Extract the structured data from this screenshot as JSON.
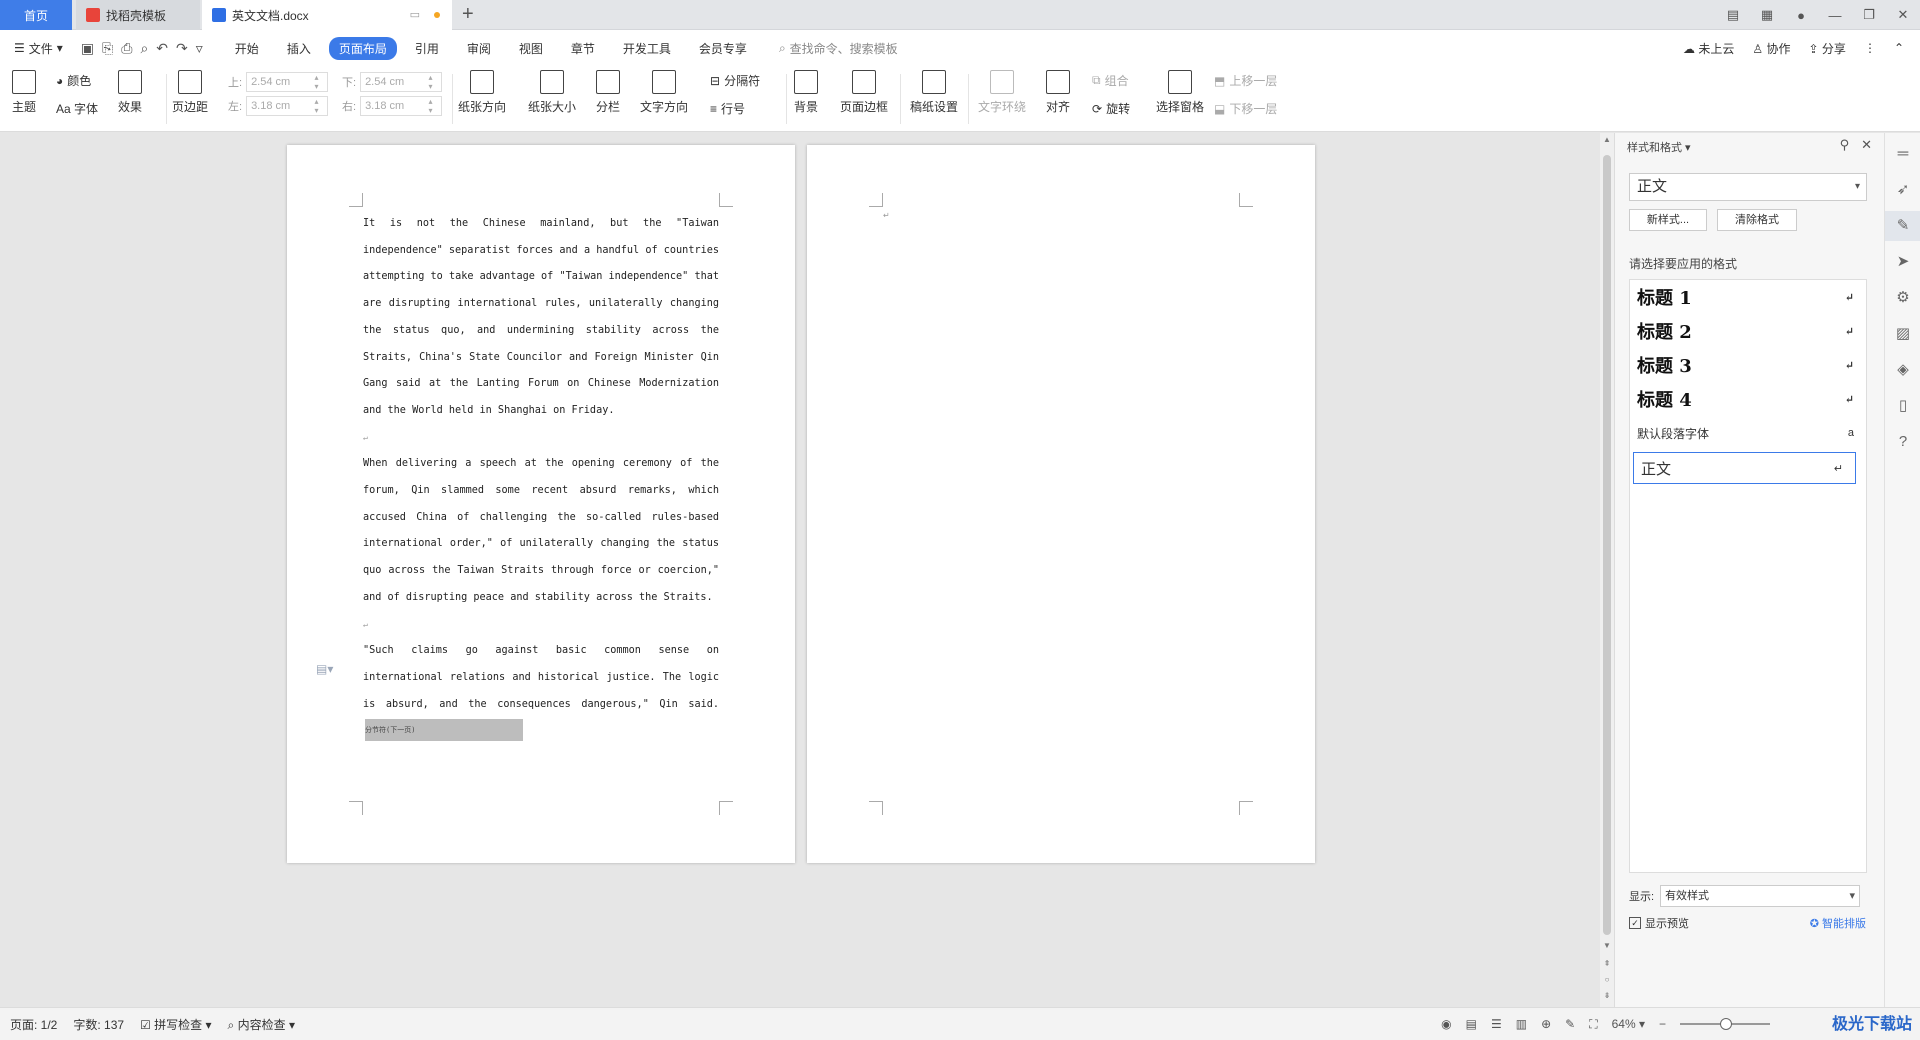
{
  "tabs": {
    "home": "首页",
    "templates": "找稻壳模板",
    "document": "英文文档.docx"
  },
  "menubar": {
    "file": "文件",
    "tabs": [
      "开始",
      "插入",
      "页面布局",
      "引用",
      "审阅",
      "视图",
      "章节",
      "开发工具",
      "会员专享"
    ],
    "active_tab": "页面布局",
    "search_placeholder": "查找命令、搜索模板",
    "not_in_cloud": "未上云",
    "collaborate": "协作",
    "share": "分享"
  },
  "ribbon": {
    "theme": "主题",
    "color": "颜色",
    "font": "Aa 字体",
    "effect": "效果",
    "margins": "页边距",
    "top_label": "上:",
    "top_value": "2.54 cm",
    "bottom_label": "下:",
    "bottom_value": "2.54 cm",
    "left_label": "左:",
    "left_value": "3.18 cm",
    "right_label": "右:",
    "right_value": "3.18 cm",
    "orientation": "纸张方向",
    "size": "纸张大小",
    "columns": "分栏",
    "text_direction": "文字方向",
    "breaks": "分隔符",
    "line_numbers": "行号",
    "background": "背景",
    "page_border": "页面边框",
    "manuscript": "稿纸设置",
    "wrap_text": "文字环绕",
    "align": "对齐",
    "rotate": "旋转",
    "group": "组合",
    "selection_pane": "选择窗格",
    "bring_forward": "上移一层",
    "send_backward": "下移一层"
  },
  "document": {
    "paragraphs": [
      "It is not the Chinese mainland, but the \"Taiwan independence\" separatist forces and a handful of countries attempting to take advantage of \"Taiwan independence\" that are disrupting international rules, unilaterally changing the status quo, and undermining stability across the Straits, China's State Councilor and Foreign Minister Qin Gang said at the Lanting Forum on Chinese Modernization and the World held in Shanghai on Friday.",
      "When delivering a speech at the opening ceremony of the forum, Qin slammed some recent absurd remarks, which accused China of challenging the so-called rules-based international order,\" of unilaterally changing the status quo across the Taiwan Straits through force or coercion,\" and of disrupting peace and stability across the Straits.",
      "\"Such claims go against basic common sense on international relations and historical justice. The logic is absurd, and the consequences dangerous,\" Qin said."
    ],
    "section_break": "分节符(下一页)"
  },
  "style_panel": {
    "title": "样式和格式",
    "current_style": "正文",
    "new_style": "新样式...",
    "clear_format": "清除格式",
    "prompt": "请选择要应用的格式",
    "styles": [
      "标题 1",
      "标题 2",
      "标题 3",
      "标题 4",
      "默认段落字体",
      "正文"
    ],
    "show_label": "显示:",
    "show_value": "有效样式",
    "preview": "显示预览",
    "smart_layout": "智能排版"
  },
  "statusbar": {
    "page": "页面: 1/2",
    "words": "字数: 137",
    "spell_check": "拼写检查",
    "content_check": "内容检查",
    "zoom": "64%"
  },
  "watermark": "极光下载站"
}
